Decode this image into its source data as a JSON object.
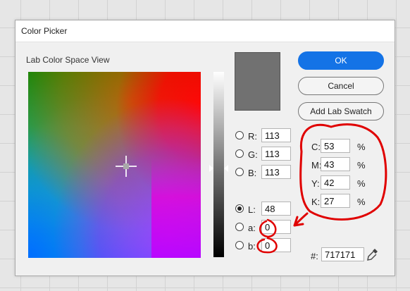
{
  "dialog": {
    "title": "Color Picker",
    "section_label": "Lab Color Space View"
  },
  "preview": {
    "color": "#717171"
  },
  "fields": {
    "R": {
      "label": "R:",
      "value": "113"
    },
    "G": {
      "label": "G:",
      "value": "113"
    },
    "B": {
      "label": "B:",
      "value": "113"
    },
    "L": {
      "label": "L:",
      "value": "48"
    },
    "a": {
      "label": "a:",
      "value": "0"
    },
    "b": {
      "label": "b:",
      "value": "0"
    },
    "selected_mode": "L"
  },
  "cmyk": {
    "C": {
      "label": "C:",
      "value": "53",
      "unit": "%"
    },
    "M": {
      "label": "M:",
      "value": "43",
      "unit": "%"
    },
    "Y": {
      "label": "Y:",
      "value": "42",
      "unit": "%"
    },
    "K": {
      "label": "K:",
      "value": "27",
      "unit": "%"
    }
  },
  "hex": {
    "label": "#:",
    "value": "717171"
  },
  "buttons": {
    "ok": "OK",
    "cancel": "Cancel",
    "add_lab_swatch": "Add Lab Swatch"
  },
  "colors": {
    "primary_button": "#1473e6",
    "annotation": "#e00000"
  }
}
